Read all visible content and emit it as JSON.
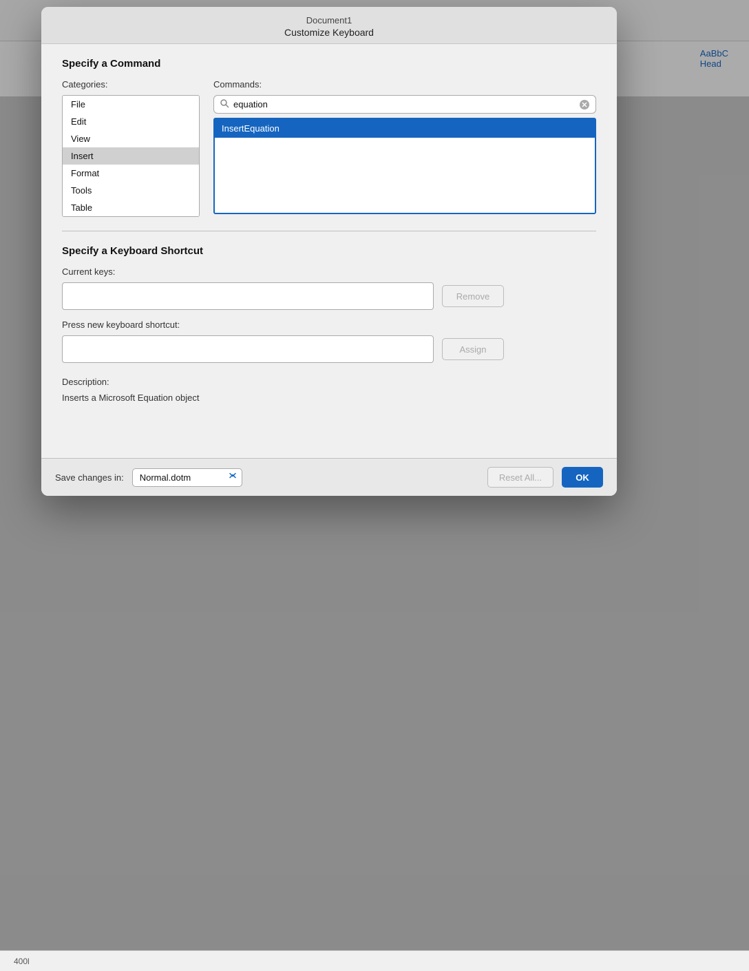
{
  "window": {
    "doc_title": "Document1",
    "dialog_title": "Customize Keyboard"
  },
  "background": {
    "style_label": "AaBbC",
    "style_sublabel": "Head"
  },
  "specify_command": {
    "section_title": "Specify a Command",
    "categories_label": "Categories:",
    "commands_label": "Commands:",
    "categories": [
      {
        "label": "File",
        "selected": false
      },
      {
        "label": "Edit",
        "selected": false
      },
      {
        "label": "View",
        "selected": false
      },
      {
        "label": "Insert",
        "selected": true
      },
      {
        "label": "Format",
        "selected": false
      },
      {
        "label": "Tools",
        "selected": false
      },
      {
        "label": "Table",
        "selected": false
      }
    ],
    "search_placeholder": "equation",
    "search_value": "equation",
    "commands": [
      {
        "label": "InsertEquation",
        "selected": true
      }
    ],
    "clear_btn_label": "✕"
  },
  "specify_shortcut": {
    "section_title": "Specify a Keyboard Shortcut",
    "current_keys_label": "Current keys:",
    "current_keys_value": "",
    "remove_btn_label": "Remove",
    "press_shortcut_label": "Press new keyboard shortcut:",
    "new_shortcut_value": "",
    "assign_btn_label": "Assign",
    "description_label": "Description:",
    "description_text": "Inserts a Microsoft Equation object"
  },
  "footer": {
    "save_changes_label": "Save changes in:",
    "save_select_value": "Normal.dotm",
    "save_options": [
      "Normal.dotm"
    ],
    "reset_btn_label": "Reset All...",
    "ok_btn_label": "OK"
  },
  "status_bar": {
    "text": "400l"
  }
}
